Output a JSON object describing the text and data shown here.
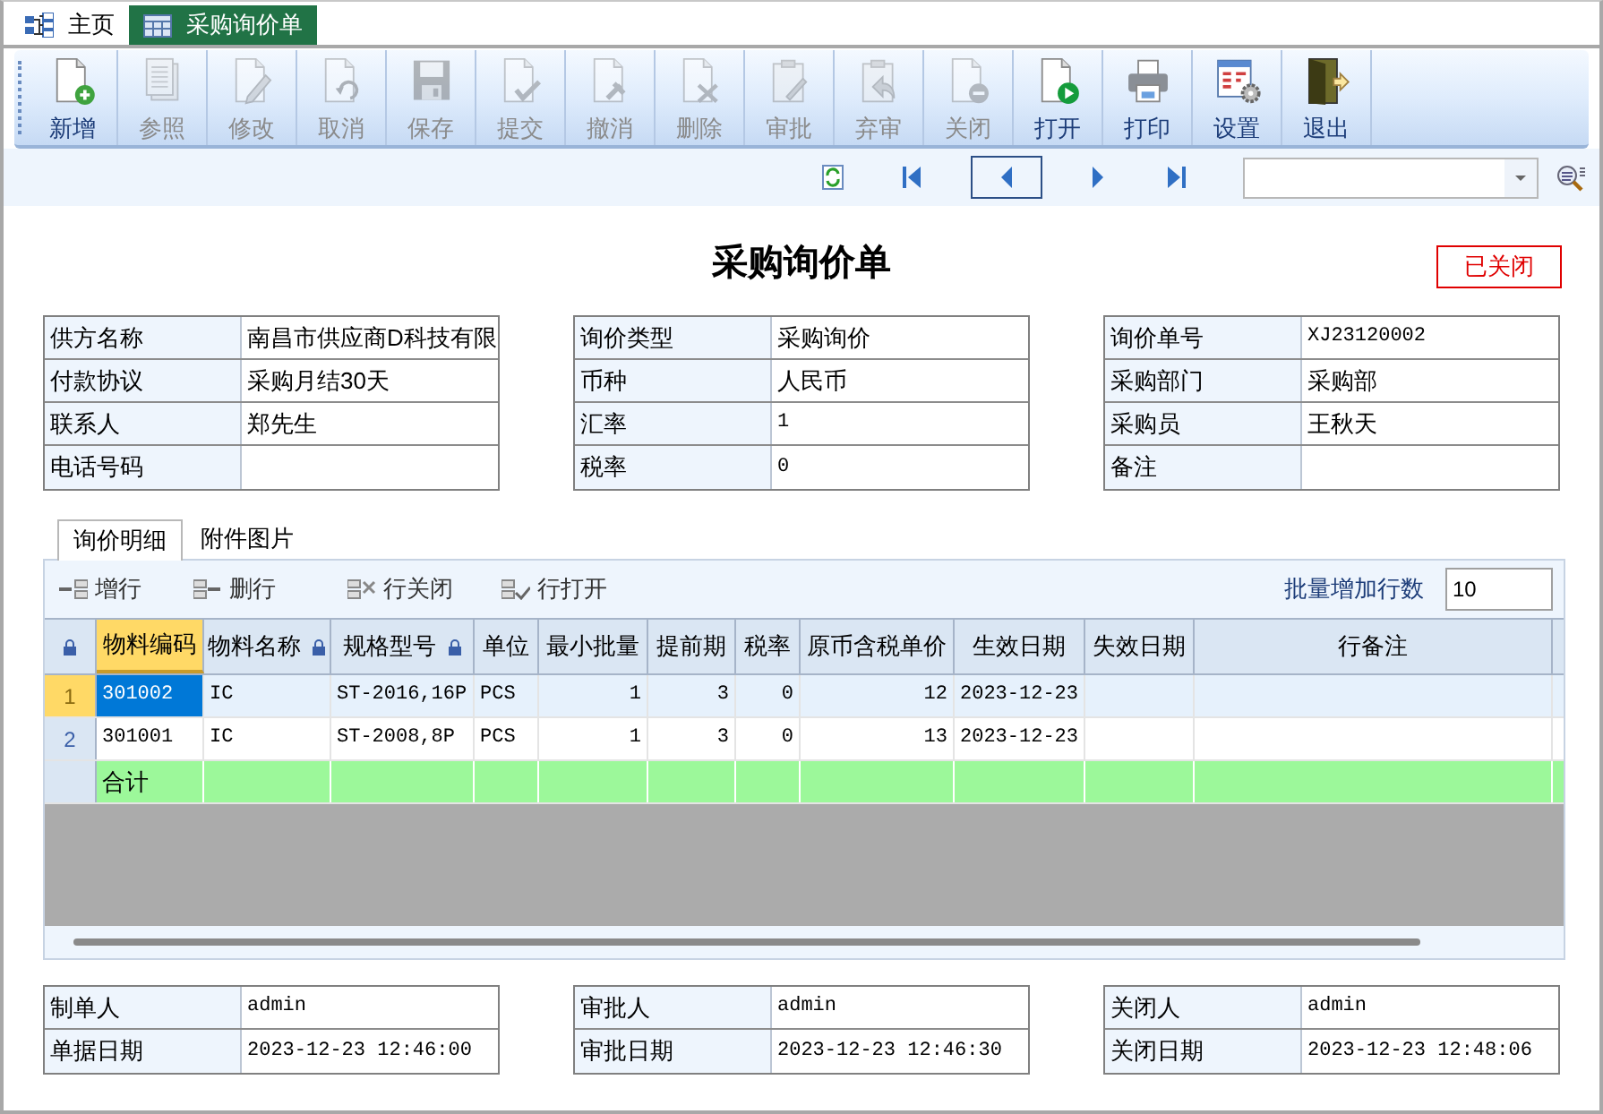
{
  "tabs": [
    {
      "label": "主页",
      "selected": false
    },
    {
      "label": "采购询价单",
      "selected": true
    }
  ],
  "toolbar": [
    {
      "label": "新增",
      "disabled": false
    },
    {
      "label": "参照",
      "disabled": true
    },
    {
      "label": "修改",
      "disabled": true
    },
    {
      "label": "取消",
      "disabled": true
    },
    {
      "label": "保存",
      "disabled": true
    },
    {
      "label": "提交",
      "disabled": true
    },
    {
      "label": "撤消",
      "disabled": true
    },
    {
      "label": "删除",
      "disabled": true
    },
    {
      "label": "审批",
      "disabled": true
    },
    {
      "label": "弃审",
      "disabled": true
    },
    {
      "label": "关闭",
      "disabled": true
    },
    {
      "label": "打开",
      "disabled": false
    },
    {
      "label": "打印",
      "disabled": false
    },
    {
      "label": "设置",
      "disabled": false
    },
    {
      "label": "退出",
      "disabled": false
    }
  ],
  "document": {
    "title": "采购询价单",
    "status": "已关闭"
  },
  "header_form": [
    [
      {
        "label": "供方名称",
        "value": "南昌市供应商D科技有限"
      },
      {
        "label": "付款协议",
        "value": "采购月结30天"
      },
      {
        "label": "联系人",
        "value": "郑先生"
      },
      {
        "label": "电话号码"
      }
    ],
    [
      {
        "label": "询价类型",
        "value": "采购询价"
      },
      {
        "label": "币种",
        "value": "人民币"
      },
      {
        "label": "汇率",
        "value": "1"
      },
      {
        "label": "税率",
        "value": "0"
      }
    ],
    [
      {
        "label": "询价单号",
        "value": "XJ23120002"
      },
      {
        "label": "采购部门",
        "value": "采购部"
      },
      {
        "label": "采购员",
        "value": "王秋天"
      },
      {
        "label": "备注"
      }
    ]
  ],
  "detail_tabs": [
    {
      "label": "询价明细",
      "selected": true
    },
    {
      "label": "附件图片",
      "selected": false
    }
  ],
  "grid_toolbar": {
    "actions": [
      "增行",
      "删行",
      "行关闭",
      "行打开"
    ],
    "batch_label": "批量增加行数",
    "batch_value": "10"
  },
  "grid": {
    "columns": [
      {
        "label": "物料编码",
        "locked": false,
        "selected": true
      },
      {
        "label": "物料名称",
        "locked": true,
        "selected": false
      },
      {
        "label": "规格型号",
        "locked": true,
        "selected": false
      },
      {
        "label": "单位",
        "locked": false,
        "selected": false
      },
      {
        "label": "最小批量",
        "locked": false,
        "selected": false
      },
      {
        "label": "提前期",
        "locked": false,
        "selected": false
      },
      {
        "label": "税率",
        "locked": false,
        "selected": false
      },
      {
        "label": "原币含税单价",
        "locked": false,
        "selected": false
      },
      {
        "label": "生效日期",
        "locked": false,
        "selected": false
      },
      {
        "label": "失效日期",
        "locked": false,
        "selected": false
      },
      {
        "label": "行备注",
        "locked": false,
        "selected": false
      }
    ],
    "rows": [
      {
        "number": "1",
        "selected": true,
        "cells": [
          "301002",
          "IC",
          "ST-2016,16P",
          "PCS",
          "1",
          "3",
          "0",
          "12",
          "2023-12-23",
          "",
          ""
        ]
      },
      {
        "number": "2",
        "selected": false,
        "cells": [
          "301001",
          "IC",
          "ST-2008,8P",
          "PCS",
          "1",
          "3",
          "0",
          "13",
          "2023-12-23",
          "",
          ""
        ]
      }
    ],
    "total_row": {
      "label": "合计"
    }
  },
  "footer_form": [
    [
      {
        "label": "制单人",
        "value": "admin"
      },
      {
        "label": "单据日期",
        "value": "2023-12-23 12:46:00"
      }
    ],
    [
      {
        "label": "审批人",
        "value": "admin"
      },
      {
        "label": "审批日期",
        "value": "2023-12-23 12:46:30"
      }
    ],
    [
      {
        "label": "关闭人",
        "value": "admin"
      },
      {
        "label": "关闭日期",
        "value": "2023-12-23 12:48:06"
      }
    ]
  ]
}
